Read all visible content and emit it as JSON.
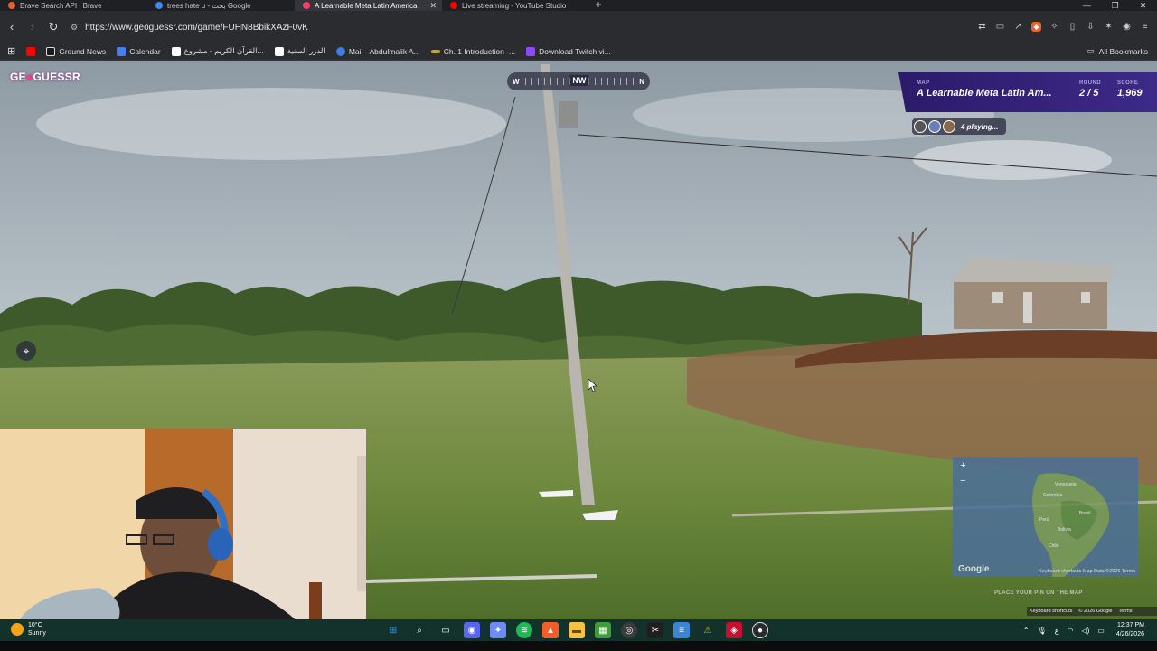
{
  "browser": {
    "tabs": [
      {
        "title": "Brave Search API | Brave",
        "icon": "brave-icon",
        "color": "#f25d2a",
        "active": false
      },
      {
        "title": "trees hate u - بحث Google",
        "icon": "google-icon",
        "color": "#4285f4",
        "active": false
      },
      {
        "title": "A Learnable Meta Latin America",
        "icon": "geoguessr-icon",
        "color": "#ff3d6a",
        "active": true
      },
      {
        "title": "Live streaming - YouTube Studio",
        "icon": "youtube-icon",
        "color": "#ff0000",
        "active": false
      }
    ],
    "tab_close_glyph": "✕",
    "new_tab_glyph": "+",
    "url": "https://www.geoguessr.com/game/FUHN8BbikXAzF0vK",
    "bookmarks": [
      {
        "label": "",
        "icon": "youtube-icon",
        "color": "#ff0000"
      },
      {
        "label": "Ground News",
        "icon": "groundnews-icon",
        "color": "#ffffff"
      },
      {
        "label": "Calendar",
        "icon": "calendar-icon",
        "color": "#4a7cf0"
      },
      {
        "label": "القرآن الكريم - مشروع...",
        "icon": "quran-icon",
        "color": "#ffffff"
      },
      {
        "label": "الدرر السنية",
        "icon": "dorar-icon",
        "color": "#ffffff"
      },
      {
        "label": "Mail - Abdulmalik A...",
        "icon": "outlook-icon",
        "color": "#3d7fe0"
      },
      {
        "label": "Ch. 1 Introduction -...",
        "icon": "book-icon",
        "color": "#c9a227"
      },
      {
        "label": "Download Twitch vi...",
        "icon": "twitch-icon",
        "color": "#9146ff"
      }
    ],
    "all_bookmarks": "All Bookmarks"
  },
  "game": {
    "logo_left": "GE",
    "logo_right": "GUESSR",
    "compass": {
      "left": "W",
      "center": "NW",
      "right": "N"
    },
    "map_label": "MAP",
    "map_name": "A Learnable Meta Latin Am...",
    "round_label": "ROUND",
    "round_value": "2 / 5",
    "score_label": "SCORE",
    "score_value": "1,969",
    "players_text": "4 playing...",
    "minimap": {
      "zoom_in": "+",
      "zoom_out": "−",
      "google": "Google",
      "attribution": "Keyboard shortcuts   Map Data ©2026   Terms",
      "labels": [
        "Venezuela",
        "Colombia",
        "Perú",
        "Brasil",
        "Bolivia",
        "Chile"
      ]
    },
    "place_hint": "PLACE YOUR PIN ON THE MAP",
    "street_footer": {
      "shortcuts": "Keyboard shortcuts",
      "copyright": "© 2026 Google",
      "terms": "Terms"
    }
  },
  "taskbar": {
    "temperature": "10°C",
    "condition": "Sunny",
    "time": "12:37 PM",
    "date": "4/26/2026",
    "lang": "ع",
    "apps": [
      {
        "name": "windows-start-icon",
        "color": "#2a9df4",
        "glyph": "⊞"
      },
      {
        "name": "search-icon",
        "color": "transparent",
        "glyph": "⌕"
      },
      {
        "name": "task-view-icon",
        "color": "transparent",
        "glyph": "▭"
      },
      {
        "name": "discord-icon",
        "color": "#5865f2",
        "glyph": "◉"
      },
      {
        "name": "copilot-icon",
        "color": "#6e8bf5",
        "glyph": "✦"
      },
      {
        "name": "spotify-icon",
        "color": "#1db954",
        "glyph": "≋"
      },
      {
        "name": "brave-icon",
        "color": "#f25d2a",
        "glyph": "▲"
      },
      {
        "name": "file-explorer-icon",
        "color": "#f6c244",
        "glyph": "▬"
      },
      {
        "name": "minecraft-icon",
        "color": "#3f9d3a",
        "glyph": "▦"
      },
      {
        "name": "obs-icon",
        "color": "#3c3c3c",
        "glyph": "◎"
      },
      {
        "name": "capcut-icon",
        "color": "#1f1f1f",
        "glyph": "✂"
      },
      {
        "name": "notepad-icon",
        "color": "#3a86d6",
        "glyph": "≡"
      },
      {
        "name": "warning-app-icon",
        "color": "#e6b800",
        "glyph": "⚠"
      },
      {
        "name": "mcafee-icon",
        "color": "#c8102e",
        "glyph": "◈"
      },
      {
        "name": "geoguessr-app-icon",
        "color": "#2c2c2c",
        "glyph": "●"
      }
    ]
  }
}
